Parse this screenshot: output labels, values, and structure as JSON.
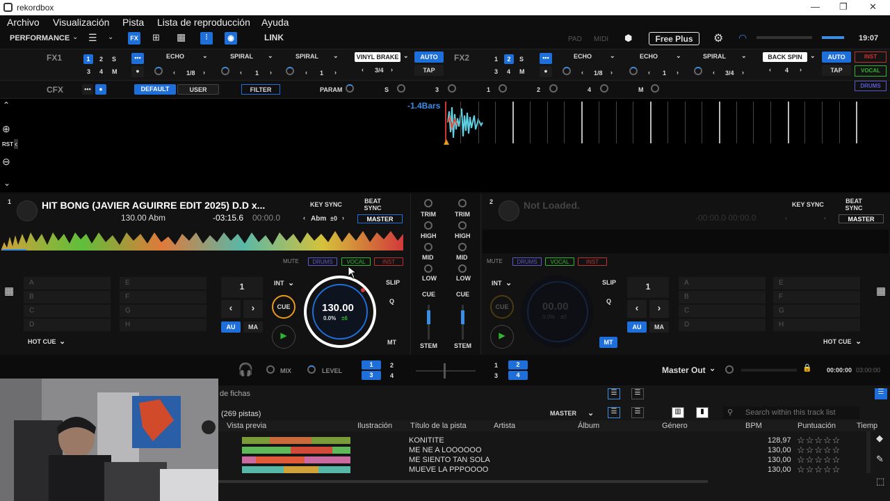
{
  "app": {
    "title": "rekordbox"
  },
  "menu": [
    "Archivo",
    "Visualización",
    "Pista",
    "Lista de reproducción",
    "Ayuda"
  ],
  "toolbar": {
    "mode": "PERFORMANCE",
    "link": "LINK",
    "pad": "PAD",
    "midi": "MIDI",
    "plan": "Free Plus",
    "time": "19:07"
  },
  "fx1": {
    "label": "FX1",
    "slots": [
      "1",
      "2",
      "S",
      "3",
      "4",
      "M"
    ],
    "effects": [
      "ECHO",
      "SPIRAL",
      "SPIRAL"
    ],
    "beats": [
      "1/8",
      "1",
      "1"
    ],
    "vinyl": "VINYL BRAKE",
    "vinyl_beat": "3/4",
    "auto": "AUTO",
    "tap": "TAP"
  },
  "fx2": {
    "label": "FX2",
    "slots": [
      "1",
      "2",
      "S",
      "3",
      "4",
      "M"
    ],
    "effects": [
      "ECHO",
      "ECHO",
      "SPIRAL"
    ],
    "beats": [
      "1/8",
      "1",
      "3/4"
    ],
    "back": "BACK SPIN",
    "back_beat": "4",
    "auto": "AUTO",
    "tap": "TAP",
    "side": [
      "INST",
      "VOCAL",
      "DRUMS"
    ]
  },
  "cfx": {
    "label": "CFX",
    "default": "DEFAULT",
    "user": "USER",
    "filter": "FILTER",
    "param": "PARAM",
    "params": [
      "S",
      "3",
      "1",
      "2",
      "4",
      "M"
    ]
  },
  "wave": {
    "bars": "-1.4Bars",
    "rst": "RST"
  },
  "deck1": {
    "num": "1",
    "title": "HIT BONG (JAVIER AGUIRRE EDIT 2025) D.D x...",
    "bpm_key": "130.00 Abm",
    "remain": "-03:15.6",
    "elapsed": "00:00.0",
    "key_sync": "KEY SYNC",
    "beat_sync": "BEAT SYNC",
    "key": "Abm",
    "key_off": "±0",
    "master": "MASTER",
    "mute": "MUTE",
    "drums": "DRUMS",
    "vocal": "VOCAL",
    "inst": "INST",
    "hotcues": [
      "A",
      "B",
      "C",
      "D",
      "E",
      "F",
      "G",
      "H"
    ],
    "hot_cue": "HOT CUE",
    "loop": "1",
    "au": "AU",
    "ma": "MA",
    "int": "INT",
    "cue": "CUE",
    "slip": "SLIP",
    "q": "Q",
    "mt": "MT",
    "jog_bpm": "130.00",
    "jog_pitch": "0.0%",
    "jog_pm": "±6"
  },
  "deck2": {
    "num": "2",
    "title": "Not Loaded.",
    "times": "-00:00.0 00:00.0",
    "key_sync": "KEY SYNC",
    "beat_sync": "BEAT SYNC",
    "master": "MASTER",
    "mute": "MUTE",
    "drums": "DRUMS",
    "vocal": "VOCAL",
    "inst": "INST",
    "hotcues": [
      "A",
      "B",
      "C",
      "D",
      "E",
      "F",
      "G",
      "H"
    ],
    "hot_cue": "HOT CUE",
    "loop": "1",
    "au": "AU",
    "ma": "MA",
    "int": "INT",
    "cue": "CUE",
    "slip": "SLIP",
    "q": "Q",
    "mt": "MT",
    "jog_bpm": "00.00",
    "jog_pitch": "0.0%",
    "jog_pm": "±0"
  },
  "mixer": {
    "labels": [
      "TRIM",
      "HIGH",
      "MID",
      "LOW"
    ],
    "cue": "CUE",
    "stem": "STEM"
  },
  "bottom": {
    "mix": "MIX",
    "level": "LEVEL",
    "decks": [
      "1",
      "2",
      "3",
      "4"
    ],
    "master_out": "Master Out",
    "time_a": "00:00:00",
    "time_b": "03:00:00"
  },
  "browser": {
    "fichas": "de fichas",
    "count": "(269 pistas)",
    "master": "MASTER",
    "search_placeholder": "Search within this track list",
    "columns": [
      "Vista previa",
      "Ilustración",
      "Título de la pista",
      "Artista",
      "Álbum",
      "Género",
      "BPM",
      "Puntuación",
      "Tiemp"
    ],
    "rows": [
      {
        "title": "KONITITE",
        "bpm": "128,97"
      },
      {
        "title": "ME NE A LOOOOOO",
        "bpm": "130,00"
      },
      {
        "title": "ME SIENTO TAN SOLA",
        "bpm": "130,00"
      },
      {
        "title": "MUEVE LA PPPOOOO",
        "bpm": "130,00"
      }
    ]
  },
  "colors": {
    "accent": "#1e6fd9",
    "drums": "#5a5acf",
    "vocal": "#2fb52f",
    "inst": "#d63b3b"
  }
}
